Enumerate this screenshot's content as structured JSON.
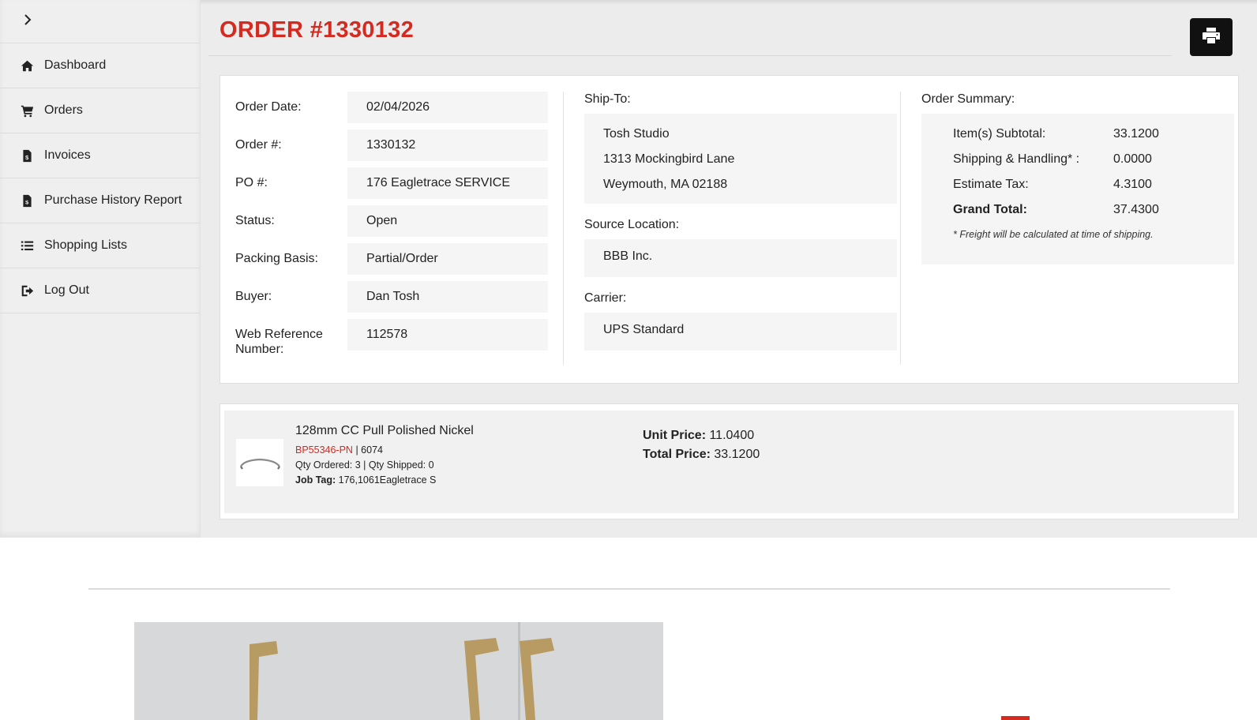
{
  "sidebar": {
    "items": [
      {
        "label": "Dashboard",
        "icon": "home-icon"
      },
      {
        "label": "Orders",
        "icon": "cart-icon"
      },
      {
        "label": "Invoices",
        "icon": "invoice-icon"
      },
      {
        "label": "Purchase History Report",
        "icon": "invoice-icon"
      },
      {
        "label": "Shopping Lists",
        "icon": "list-icon"
      },
      {
        "label": "Log Out",
        "icon": "logout-icon"
      }
    ]
  },
  "header": {
    "title": "ORDER #1330132"
  },
  "order": {
    "fields": [
      {
        "label": "Order Date:",
        "value": "02/04/2026"
      },
      {
        "label": "Order #:",
        "value": "1330132"
      },
      {
        "label": "PO #:",
        "value": "176 Eagletrace SERVICE"
      },
      {
        "label": "Status:",
        "value": "Open"
      },
      {
        "label": "Packing Basis:",
        "value": "Partial/Order"
      },
      {
        "label": "Buyer:",
        "value": "Dan Tosh"
      },
      {
        "label": "Web Reference Number:",
        "value": "112578"
      }
    ],
    "ship_to": {
      "label": "Ship-To:",
      "lines": [
        "Tosh Studio",
        "1313 Mockingbird Lane",
        "Weymouth, MA 02188"
      ]
    },
    "source_location": {
      "label": "Source Location:",
      "value": "BBB Inc."
    },
    "carrier": {
      "label": "Carrier:",
      "value": "UPS Standard"
    },
    "summary": {
      "label": "Order Summary:",
      "rows": [
        {
          "key": "Item(s) Subtotal:",
          "value": "33.1200"
        },
        {
          "key": "Shipping & Handling* :",
          "value": "0.0000"
        },
        {
          "key": "Estimate Tax:",
          "value": "4.3100"
        },
        {
          "key": "Grand Total:",
          "value": "37.4300"
        }
      ],
      "note": "* Freight will be calculated at time of shipping."
    }
  },
  "line_item": {
    "name": "128mm CC Pull Polished Nickel",
    "sku": "BP55346-PN",
    "sku_suffix": " | 6074",
    "qty_line": "Qty Ordered: 3 | Qty Shipped: 0",
    "job_tag_label": "Job Tag:",
    "job_tag_value": " 176,1061Eagletrace S",
    "unit_price_label": "Unit Price:",
    "unit_price_value": " 11.0400",
    "total_price_label": "Total Price:",
    "total_price_value": " 33.1200"
  },
  "colors": {
    "accent": "#d42a20",
    "sidebar_bg": "#efefef",
    "print_button": "#111111"
  }
}
